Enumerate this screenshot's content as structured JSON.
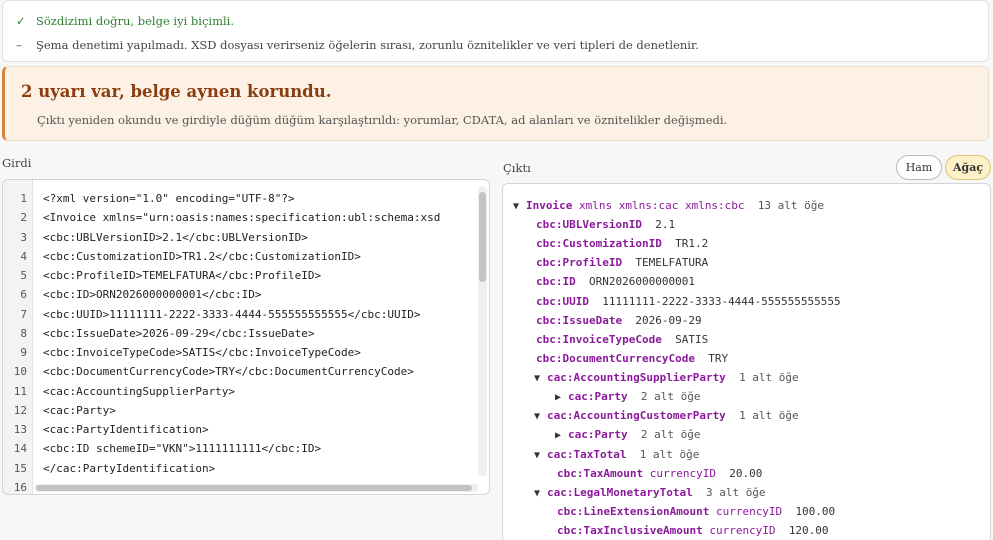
{
  "status": {
    "ok_symbol": "✓",
    "ok_text": "Sözdizimi doğru, belge iyi biçimli.",
    "note_symbol": "–",
    "note_text": "Şema denetimi yapılmadı. XSD dosyası verirseniz öğelerin sırası, zorunlu öznitelikler ve veri tipleri de denetlenir."
  },
  "warning": {
    "title": "2 uyarı var, belge aynen korundu.",
    "description": "Çıktı yeniden okundu ve girdiyle düğüm düğüm karşılaştırıldı: yorumlar, CDATA, ad alanları ve öznitelikler değişmedi."
  },
  "input": {
    "label": "Girdi",
    "lines": [
      {
        "n": "1",
        "text": "<?xml version=\"1.0\" encoding=\"UTF-8\"?>"
      },
      {
        "n": "2",
        "text": "<Invoice xmlns=\"urn:oasis:names:specification:ubl:schema:xsd"
      },
      {
        "n": "3",
        "text": "<cbc:UBLVersionID>2.1</cbc:UBLVersionID>"
      },
      {
        "n": "4",
        "text": "<cbc:CustomizationID>TR1.2</cbc:CustomizationID>"
      },
      {
        "n": "5",
        "text": "<cbc:ProfileID>TEMELFATURA</cbc:ProfileID>"
      },
      {
        "n": "6",
        "text": "<cbc:ID>ORN2026000000001</cbc:ID>"
      },
      {
        "n": "7",
        "text": "<cbc:UUID>11111111-2222-3333-4444-555555555555</cbc:UUID>"
      },
      {
        "n": "8",
        "text": "<cbc:IssueDate>2026-09-29</cbc:IssueDate>"
      },
      {
        "n": "9",
        "text": "<cbc:InvoiceTypeCode>SATIS</cbc:InvoiceTypeCode>"
      },
      {
        "n": "10",
        "text": "<cbc:DocumentCurrencyCode>TRY</cbc:DocumentCurrencyCode>"
      },
      {
        "n": "11",
        "text": "<cac:AccountingSupplierParty>"
      },
      {
        "n": "12",
        "text": "<cac:Party>"
      },
      {
        "n": "13",
        "text": "<cac:PartyIdentification>"
      },
      {
        "n": "14",
        "text": "<cbc:ID schemeID=\"VKN\">1111111111</cbc:ID>"
      },
      {
        "n": "15",
        "text": "</cac:PartyIdentification>"
      },
      {
        "n": "16",
        "text": ""
      }
    ]
  },
  "output": {
    "label": "Çıktı",
    "buttons": {
      "raw": "Ham",
      "tree": "Ağaç"
    },
    "tree": [
      {
        "toggle": "▼",
        "tag": "Invoice",
        "attrs": "xmlns xmlns:cac xmlns:cbc",
        "count": "13 alt öğe",
        "value": ""
      },
      {
        "toggle": "",
        "tag": "cbc:UBLVersionID",
        "attrs": "",
        "count": "",
        "value": "2.1"
      },
      {
        "toggle": "",
        "tag": "cbc:CustomizationID",
        "attrs": "",
        "count": "",
        "value": "TR1.2"
      },
      {
        "toggle": "",
        "tag": "cbc:ProfileID",
        "attrs": "",
        "count": "",
        "value": "TEMELFATURA"
      },
      {
        "toggle": "",
        "tag": "cbc:ID",
        "attrs": "",
        "count": "",
        "value": "ORN2026000000001"
      },
      {
        "toggle": "",
        "tag": "cbc:UUID",
        "attrs": "",
        "count": "",
        "value": "11111111-2222-3333-4444-555555555555"
      },
      {
        "toggle": "",
        "tag": "cbc:IssueDate",
        "attrs": "",
        "count": "",
        "value": "2026-09-29"
      },
      {
        "toggle": "",
        "tag": "cbc:InvoiceTypeCode",
        "attrs": "",
        "count": "",
        "value": "SATIS"
      },
      {
        "toggle": "",
        "tag": "cbc:DocumentCurrencyCode",
        "attrs": "",
        "count": "",
        "value": "TRY"
      },
      {
        "toggle": "▼",
        "tag": "cac:AccountingSupplierParty",
        "attrs": "",
        "count": "1 alt öğe",
        "value": ""
      },
      {
        "toggle": "▶",
        "tag": "cac:Party",
        "attrs": "",
        "count": "2 alt öğe",
        "value": ""
      },
      {
        "toggle": "▼",
        "tag": "cac:AccountingCustomerParty",
        "attrs": "",
        "count": "1 alt öğe",
        "value": ""
      },
      {
        "toggle": "▶",
        "tag": "cac:Party",
        "attrs": "",
        "count": "2 alt öğe",
        "value": ""
      },
      {
        "toggle": "▼",
        "tag": "cac:TaxTotal",
        "attrs": "",
        "count": "1 alt öğe",
        "value": ""
      },
      {
        "toggle": "",
        "tag": "cbc:TaxAmount",
        "attrs": "currencyID",
        "count": "",
        "value": "20.00"
      },
      {
        "toggle": "▼",
        "tag": "cac:LegalMonetaryTotal",
        "attrs": "",
        "count": "3 alt öğe",
        "value": ""
      },
      {
        "toggle": "",
        "tag": "cbc:LineExtensionAmount",
        "attrs": "currencyID",
        "count": "",
        "value": "100.00"
      },
      {
        "toggle": "",
        "tag": "cbc:TaxInclusiveAmount",
        "attrs": "currencyID",
        "count": "",
        "value": "120.00"
      }
    ]
  }
}
